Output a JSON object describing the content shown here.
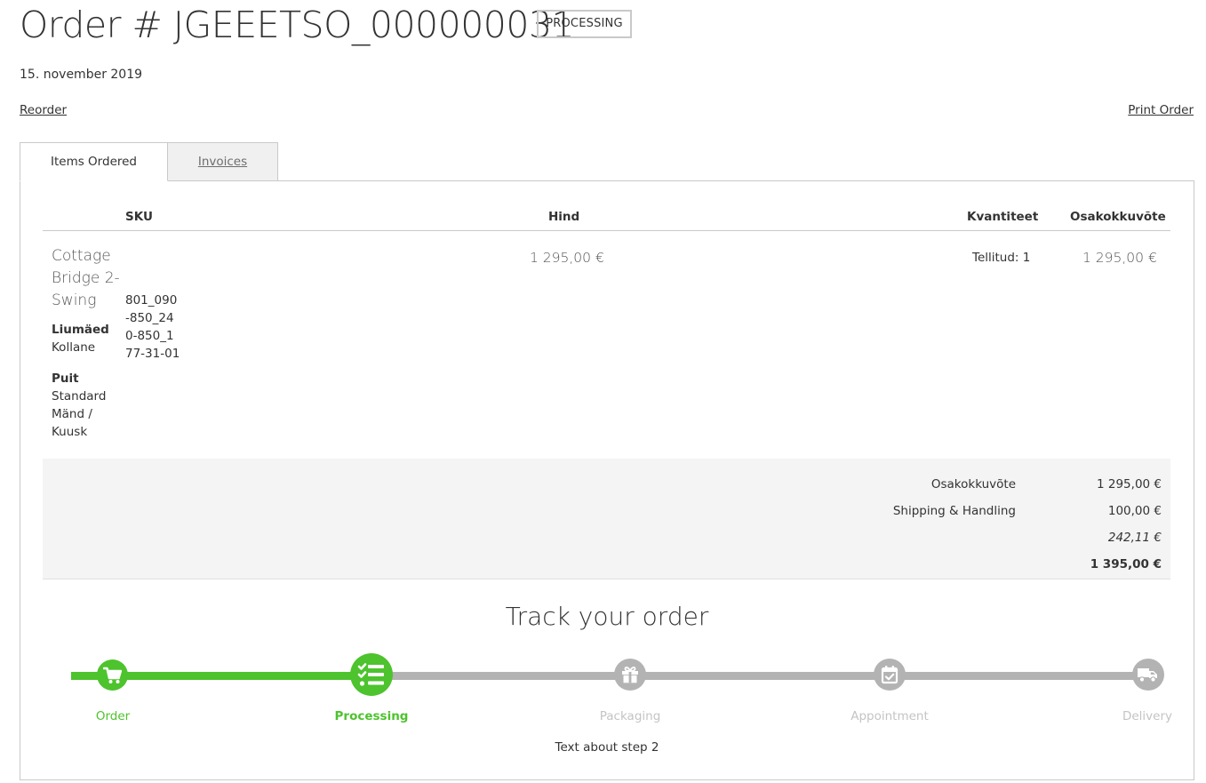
{
  "header": {
    "title": "Order # JGEEETSO_000000031",
    "status": "PROCESSING",
    "date": "15. november 2019"
  },
  "actions": {
    "reorder": "Reorder",
    "print_order": "Print Order"
  },
  "tabs": [
    {
      "label": "Items Ordered",
      "active": true
    },
    {
      "label": "Invoices",
      "active": false
    }
  ],
  "table": {
    "columns": {
      "sku": "SKU",
      "price": "Hind",
      "qty": "Kvantiteet",
      "subtotal": "Osakokkuvõte"
    },
    "items": [
      {
        "name": "Cottage Bridge 2-Swing",
        "options": [
          {
            "label": "Liumäed",
            "value": "Kollane"
          },
          {
            "label": "Puit",
            "value": "Standard Mänd / Kuusk"
          }
        ],
        "sku": "801_090-850_240-850_177-31-01",
        "price": "1 295,00 €",
        "qty": "Tellitud: 1",
        "subtotal": "1 295,00 €"
      }
    ]
  },
  "totals": {
    "subtotal_label": "Osakokkuvõte",
    "subtotal_value": "1 295,00 €",
    "shipping_label": "Shipping & Handling",
    "shipping_value": "100,00 €",
    "tax_value": "242,11 €",
    "grand_total_value": "1 395,00 €"
  },
  "tracking": {
    "title": "Track your order",
    "current_step": 2,
    "steps": [
      {
        "label": "Order",
        "icon": "cart-icon",
        "state": "done"
      },
      {
        "label": "Processing",
        "icon": "checklist-icon",
        "state": "current"
      },
      {
        "label": "Packaging",
        "icon": "gift-icon",
        "state": "pending"
      },
      {
        "label": "Appointment",
        "icon": "calendar-check-icon",
        "state": "pending"
      },
      {
        "label": "Delivery",
        "icon": "truck-icon",
        "state": "pending"
      }
    ],
    "step_text": "Text about step 2"
  },
  "colors": {
    "done": "#4dc32d",
    "pending": "#b3b3b3",
    "pending_label": "#c4c4c4",
    "totals_bg": "#f4f4f4"
  }
}
